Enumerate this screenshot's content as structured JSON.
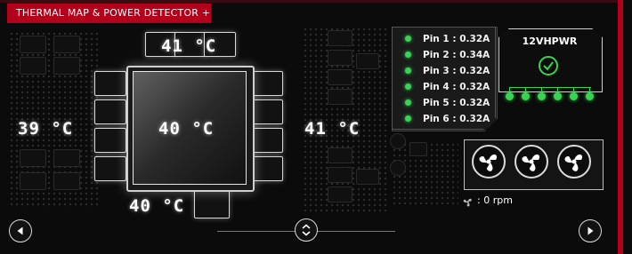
{
  "header": {
    "title": "THERMAL MAP & POWER DETECTOR +"
  },
  "thermal": {
    "top": "41 °C",
    "left": "39 °C",
    "center": "40 °C",
    "right": "41 °C",
    "bottom": "40 °C"
  },
  "power": {
    "pins": [
      {
        "label": "Pin 1 : 0.32A",
        "status": "ok"
      },
      {
        "label": "Pin 2 : 0.34A",
        "status": "ok"
      },
      {
        "label": "Pin 3 : 0.32A",
        "status": "ok"
      },
      {
        "label": "Pin 4 : 0.32A",
        "status": "ok"
      },
      {
        "label": "Pin 5 : 0.32A",
        "status": "ok"
      },
      {
        "label": "Pin 6 : 0.32A",
        "status": "ok"
      }
    ],
    "connector_label": "12VHPWR",
    "connector_status": "check-icon"
  },
  "fans": {
    "count": 3,
    "rpm_label": ": 0 rpm",
    "icon": "fan-icon"
  },
  "colors": {
    "accent": "#b3001b",
    "ok": "#39d353"
  },
  "nav": {
    "prev_icon": "play-left-icon",
    "next_icon": "play-right-icon",
    "toggle_icon": "chevron-up-down-icon"
  }
}
